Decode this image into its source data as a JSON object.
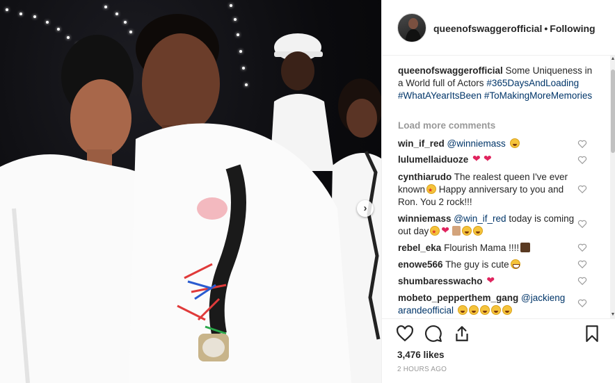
{
  "post": {
    "username": "queenofswaggerofficial",
    "separator": "•",
    "follow_status": "Following"
  },
  "caption": {
    "username": "queenofswaggerofficial",
    "text": "Some Uniqueness in a World full of Actors",
    "hashtags": [
      "#365DaysAndLoading",
      "#WhatAYearItsBeen",
      "#ToMakingMoreMemories"
    ]
  },
  "load_more": "Load more comments",
  "comments": [
    {
      "user": "win_if_red",
      "text": "@winniemass",
      "emojis": [
        "laugh"
      ]
    },
    {
      "user": "lulumellaiduoze",
      "text": "",
      "emojis": [
        "heart",
        "heart"
      ]
    },
    {
      "user": "cynthiarudo",
      "text_a": "The realest queen I've ever known",
      "text_b": "Happy anniversary to you and Ron. You 2 rock!!!",
      "emojis": [
        "star"
      ]
    },
    {
      "user": "winniemass",
      "mention": "@win_if_red",
      "text": "today is coming out day",
      "emojis": [
        "star",
        "heart",
        "pray",
        "laugh",
        "laugh"
      ]
    },
    {
      "user": "rebel_eka",
      "text": "Flourish Mama !!!!",
      "emojis": [
        "raise"
      ]
    },
    {
      "user": "enowe566",
      "text": "The guy is cute",
      "emojis": [
        "grin"
      ]
    },
    {
      "user": "shumbaresswacho",
      "text": "",
      "emojis": [
        "heart"
      ]
    },
    {
      "user": "mobeto_pepperthem_gang",
      "mention": "@jackieng arandeofficial",
      "text": "",
      "emojis": [
        "laugh",
        "laugh",
        "laugh",
        "laugh",
        "laugh"
      ]
    }
  ],
  "likes": "3,476 likes",
  "time": "2 HOURS AGO",
  "colors": {
    "link": "#003569",
    "muted": "#999999",
    "heart_red": "#e0245e"
  },
  "icons": {
    "like": "heart-outline-icon",
    "comment": "comment-bubble-icon",
    "share": "share-icon",
    "save": "bookmark-icon",
    "next": "chevron-right-icon"
  }
}
